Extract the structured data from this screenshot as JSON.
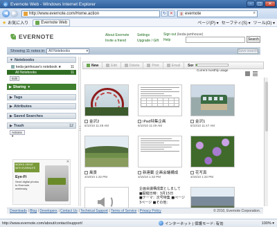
{
  "browser": {
    "window_title": "Evernote Web - Windows Internet Explorer",
    "address": "http://www.evernote.com/Home.action",
    "search_placeholder": "evernote",
    "favorites_label": "お気に入り",
    "tab_label": "Evernote Web",
    "tools": [
      "ページ(P) ▾",
      "セーフティ(S) ▾",
      "ツール(O) ▾"
    ],
    "status_url": "http://www.evernote.com/about/contact/support/",
    "status_zone": "インターネット | 保護モード: 有効",
    "zoom": "100% ▾"
  },
  "header": {
    "logo": "EVERNOTE",
    "links_col1": [
      "About Evernote",
      "Invite a friend"
    ],
    "links_col2": [
      "Settings",
      "Upgrade / Gift"
    ],
    "signout": "Sign out",
    "username": "(keda-jamhouse)",
    "help": "Help",
    "search_button": "Search"
  },
  "showing": {
    "text": "Showing 11 notes in",
    "notebook": "All Notebooks",
    "save_search": "Save search"
  },
  "sidebar": {
    "notebooks_title": "Notebooks",
    "notebook_items": [
      {
        "label": "keda-jamhouse's notebook ★",
        "count": "11"
      },
      {
        "label": "All Notebooks",
        "count": "11"
      }
    ],
    "edit_label": "Edit",
    "sharing_title": "Sharing",
    "tags_title": "Tags",
    "attributes_title": "Attributes",
    "saved_searches_title": "Saved Searches",
    "trash_title": "Trash",
    "trash_count": "12",
    "actions_label": "Actions ▾"
  },
  "ad": {
    "badge": "WORKS GREAT WITH EVERNOTE",
    "product": "Eye-Fi",
    "text": "Send digital photos to Evernote wirelessly"
  },
  "toolbar": {
    "buttons": [
      "New",
      "Edit",
      "Delete",
      "Print",
      "Email",
      "Sor"
    ],
    "usage_label": "Current monthly usage",
    "usage_fraction": 0.04
  },
  "notes": [
    {
      "title": "金沢2",
      "date": "6/10/10 11:49 AM",
      "thumb": "ferris"
    },
    {
      "title": "iPad特集企画",
      "date": "6/10/10 11:49 AM",
      "thumb": "doc"
    },
    {
      "title": "金沢1",
      "date": "6/10/10 11:47 AM",
      "thumb": "tram"
    },
    {
      "title": "風景",
      "date": "3/19/10 1:32 PM",
      "thumb": "landscape"
    },
    {
      "title": "新連載 企画会議構成",
      "date": "3/15/10 1:32 PM",
      "thumb": "doc2"
    },
    {
      "title": "花写真",
      "date": "3/15/10 1:32 PM",
      "thumb": "flowers"
    }
  ],
  "text_note_lines": [
    "企画会議構成案としまして",
    "■開催日時：3月15日",
    "■テーマ：次号特集 ■ページ",
    "3ページ ■その他："
  ],
  "footer": {
    "links": [
      "Downloads",
      "Blog",
      "Developers",
      "Contact Us",
      "Technical Support",
      "Terms of Service",
      "Privacy Policy"
    ],
    "copyright": "© 2010, Evernote Corporation."
  }
}
